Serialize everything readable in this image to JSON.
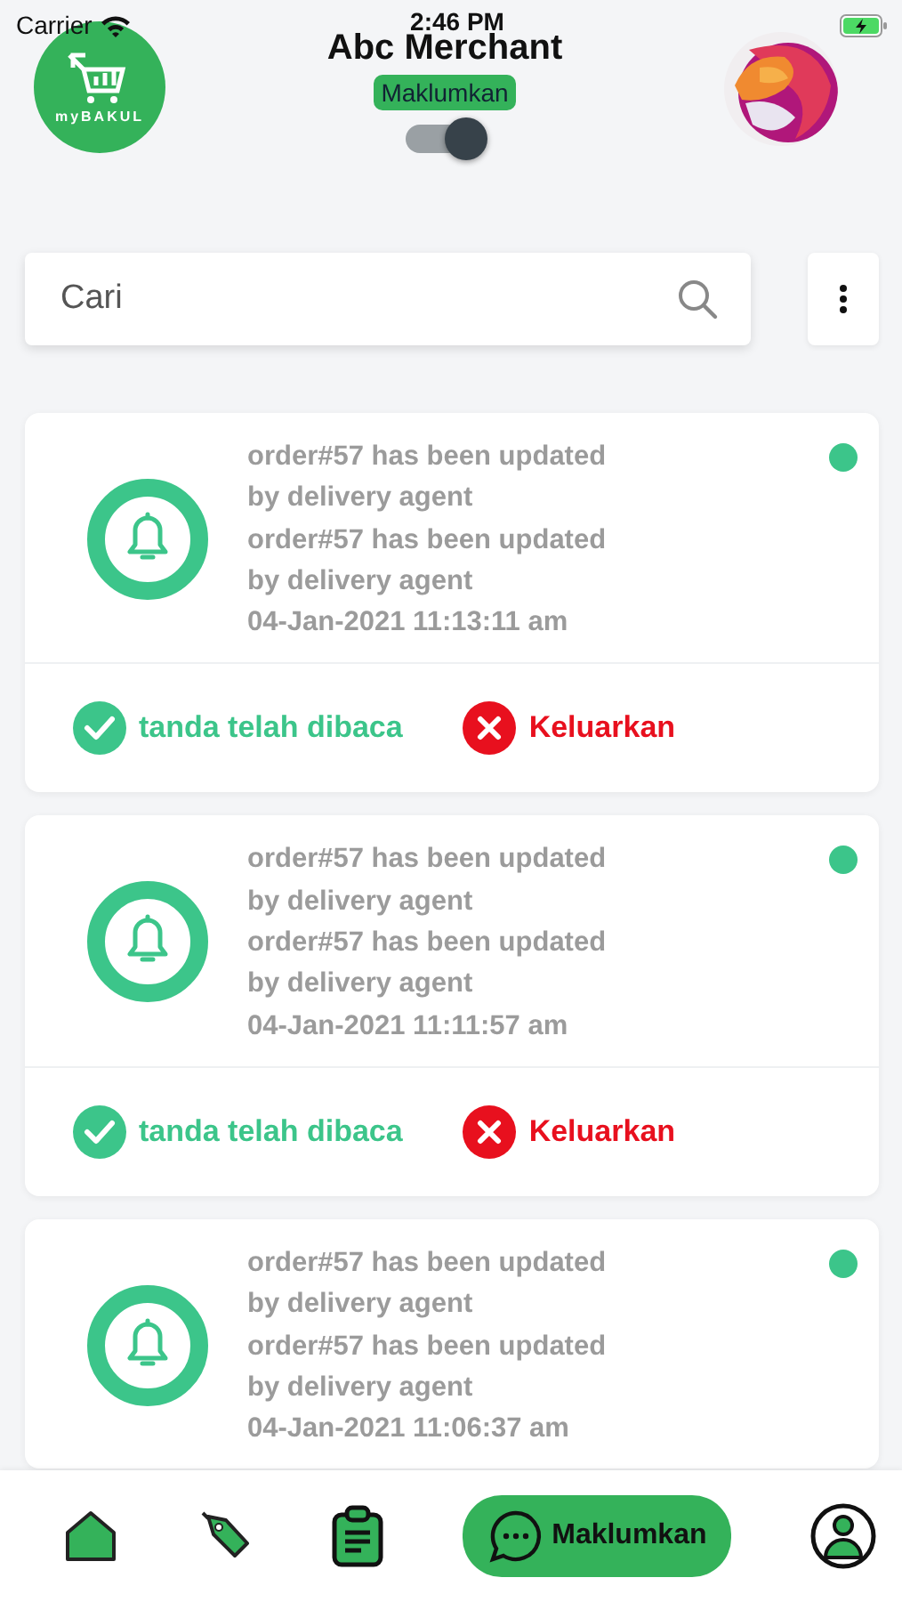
{
  "status_bar": {
    "carrier": "Carrier",
    "time": "2:46 PM"
  },
  "header": {
    "logo_text": "myBAKUL",
    "title": "Abc Merchant",
    "badge": "Maklumkan",
    "toggle": {
      "on": true
    }
  },
  "search": {
    "placeholder": "Cari"
  },
  "notifications": [
    {
      "lines": [
        "order#57 has been updated",
        "by delivery agent",
        "order#57 has been updated",
        "by delivery agent"
      ],
      "time": "04-Jan-2021 11:13:11 am",
      "unread": true,
      "actions": [
        {
          "kind": "read",
          "label": "tanda telah dibaca"
        },
        {
          "kind": "remove",
          "label": "Keluarkan"
        }
      ]
    },
    {
      "lines": [
        "order#57 has been updated",
        "by delivery agent",
        "order#57 has been updated",
        "by delivery agent"
      ],
      "time": "04-Jan-2021 11:11:57 am",
      "unread": true,
      "actions": [
        {
          "kind": "read",
          "label": "tanda telah dibaca"
        },
        {
          "kind": "remove",
          "label": "Keluarkan"
        }
      ]
    },
    {
      "lines": [
        "order#57 has been updated",
        "by delivery agent",
        "order#57 has been updated",
        "by delivery agent"
      ],
      "time": "04-Jan-2021 11:06:37 am",
      "unread": true
    }
  ],
  "bottom_nav": [
    {
      "kind": "home",
      "selected": false
    },
    {
      "kind": "tag",
      "selected": false
    },
    {
      "kind": "orders",
      "selected": false
    },
    {
      "kind": "notify",
      "label": "Maklumkan",
      "selected": true
    },
    {
      "kind": "profile",
      "selected": false
    }
  ]
}
